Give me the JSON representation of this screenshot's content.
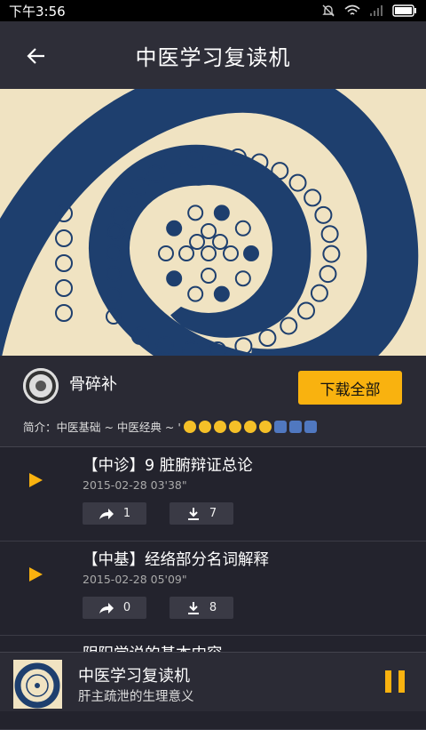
{
  "status": {
    "time": "下午3:56"
  },
  "header": {
    "title": "中医学习复读机"
  },
  "album": {
    "author": "骨碎补",
    "download_all": "下载全部",
    "intro": "简介：中医基础 ~ 中医经典 ~ '"
  },
  "tracks": [
    {
      "title": "【中诊】9 脏腑辩证总论",
      "date": "2015-02-28",
      "duration": "03'38\"",
      "shares": "1",
      "downloads": "7"
    },
    {
      "title": "【中基】经络部分名词解释",
      "date": "2015-02-28",
      "duration": "05'09\"",
      "shares": "0",
      "downloads": "8"
    },
    {
      "title": "阴阳学说的基本内容"
    }
  ],
  "player": {
    "title": "中医学习复读机",
    "subtitle": "肝主疏泄的生理意义"
  },
  "colors": {
    "accent": "#f9b20f",
    "background": "#23232d",
    "spiral": "#1e3f6e",
    "paper": "#f0e3c2"
  },
  "icons": [
    "back-arrow-icon",
    "play-icon",
    "share-icon",
    "download-icon",
    "pause-icon",
    "bell-off-icon",
    "wifi-icon",
    "signal-icon",
    "battery-icon"
  ]
}
